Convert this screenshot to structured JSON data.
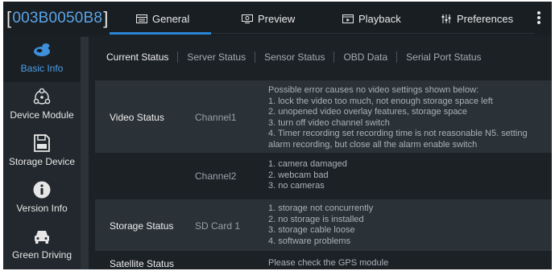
{
  "header": {
    "device_id": "003B0050B8",
    "bracket_open": "[",
    "bracket_close": "]",
    "tabs": [
      {
        "label": "General",
        "icon": "general-icon"
      },
      {
        "label": "Preview",
        "icon": "preview-icon"
      },
      {
        "label": "Playback",
        "icon": "playback-icon"
      },
      {
        "label": "Preferences",
        "icon": "preferences-icon"
      }
    ],
    "active_tab": "General",
    "accent_color": "#2b86d6"
  },
  "sidebar": {
    "items": [
      {
        "label": "Basic Info",
        "icon": "basic-info-icon",
        "active": true
      },
      {
        "label": "Device Module",
        "icon": "device-module-icon"
      },
      {
        "label": "Storage Device",
        "icon": "storage-device-icon"
      },
      {
        "label": "Version Info",
        "icon": "version-info-icon"
      },
      {
        "label": "Green Driving",
        "icon": "car-icon"
      }
    ]
  },
  "subtabs": [
    "Current Status",
    "Server Status",
    "Sensor Status",
    "OBD Data",
    "Serial Port Status"
  ],
  "active_subtab": "Current Status",
  "status": {
    "video": {
      "label": "Video Status",
      "ch1": "Channel1",
      "ch1_lines": [
        "Possible error causes no video settings shown below:",
        "1. lock the video too much, not enough storage space left",
        "2. unopened video overlay features, storage space",
        "3. turn off video channel switch",
        "4. Timer recording set recording time is not reasonable N5. setting",
        "alarm recording, but close all the alarm enable switch"
      ],
      "ch2": "Channel2",
      "ch2_lines": [
        "1. camera damaged",
        "2. webcam bad",
        "3. no cameras"
      ]
    },
    "storage": {
      "label": "Storage Status",
      "medium": "SD Card 1",
      "lines": [
        "1. storage not concurrently",
        "2. no storage is installed",
        "3. storage cable loose",
        "4. software problems"
      ]
    },
    "satellite": {
      "label": "Satellite Status",
      "lines": [
        "Please check the GPS module"
      ]
    }
  }
}
